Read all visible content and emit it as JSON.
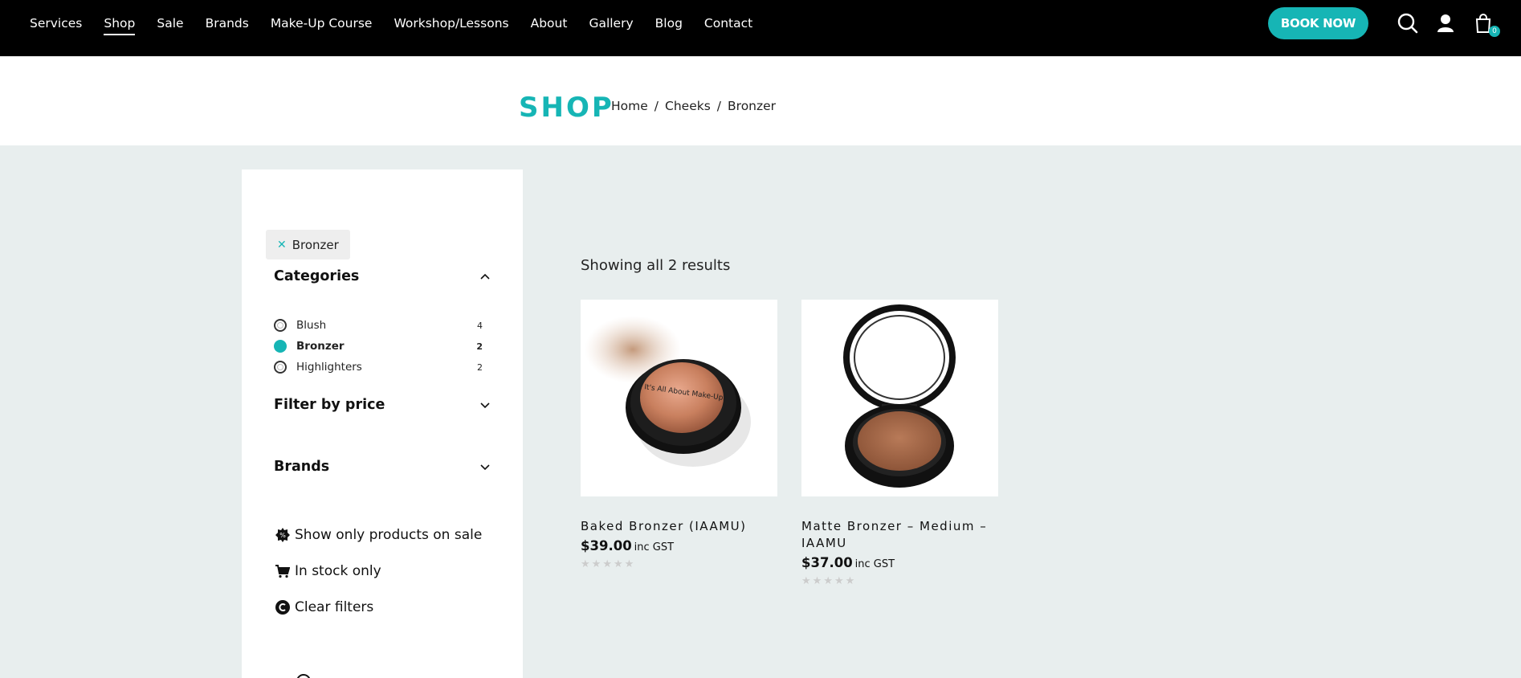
{
  "nav": {
    "items": [
      {
        "label": "Services"
      },
      {
        "label": "Shop",
        "active": true
      },
      {
        "label": "Sale"
      },
      {
        "label": "Brands"
      },
      {
        "label": "Make-Up Course"
      },
      {
        "label": "Workshop/Lessons"
      },
      {
        "label": "About"
      },
      {
        "label": "Gallery"
      },
      {
        "label": "Blog"
      },
      {
        "label": "Contact"
      }
    ],
    "book_label": "BOOK NOW",
    "cart_count": "0"
  },
  "header": {
    "title": "SHOP",
    "breadcrumb": [
      "Home",
      "/",
      "Cheeks",
      "/",
      "Bronzer"
    ]
  },
  "sidebar": {
    "active_filter": "Bronzer",
    "categories_label": "Categories",
    "categories": [
      {
        "name": "Blush",
        "count": "4"
      },
      {
        "name": "Bronzer",
        "count": "2",
        "selected": true
      },
      {
        "name": "Highlighters",
        "count": "2"
      }
    ],
    "price_label": "Filter by price",
    "brands_label": "Brands",
    "sale_label": "Show only products on sale",
    "stock_label": "In stock only",
    "clear_label": "Clear filters"
  },
  "results": {
    "count_text": "Showing all 2 results",
    "products": [
      {
        "name": "Baked Bronzer (IAAMU)",
        "price": "$39.00",
        "tax": "inc GST",
        "rating": 0,
        "lid_text": "It's All About Make-Up"
      },
      {
        "name": "Matte Bronzer – Medium – IAAMU",
        "price": "$37.00",
        "tax": "inc GST",
        "rating": 0
      }
    ]
  },
  "colors": {
    "accent": "#16b5b5",
    "topbar": "#000000",
    "page_bg": "#e8eeee"
  }
}
